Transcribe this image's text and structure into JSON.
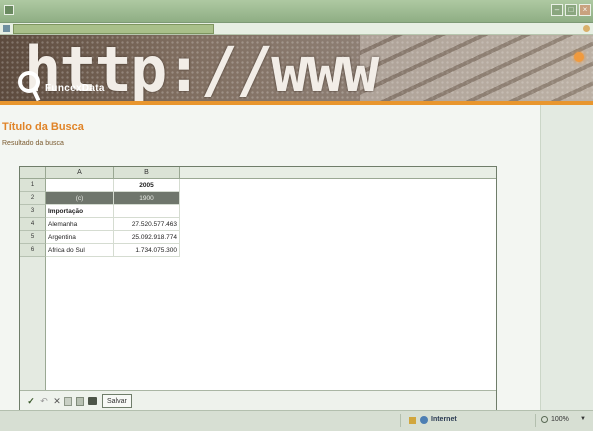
{
  "window": {
    "title": "",
    "url": ""
  },
  "banner": {
    "big_text": "http://www",
    "logo_text": "FuncexData"
  },
  "page": {
    "title": "Título da Busca",
    "subtitle": "Resultado da busca"
  },
  "sheet": {
    "columns": [
      "A",
      "B"
    ],
    "rows": [
      {
        "num": "1",
        "a": "",
        "b": "2005"
      },
      {
        "num": "2",
        "a": "(c)",
        "b": "1900"
      },
      {
        "num": "3",
        "a": "Importação",
        "b": ""
      },
      {
        "num": "4",
        "a": "Alemanha",
        "b": "27.520.577.463"
      },
      {
        "num": "5",
        "a": "Argentina",
        "b": "25.092.918.774"
      },
      {
        "num": "6",
        "a": "Africa do Sul",
        "b": "1.734.075.300"
      }
    ],
    "save_label": "Salvar"
  },
  "toolbar_icons": [
    "check-icon",
    "undo-icon",
    "cut-icon",
    "copy-icon",
    "paste-icon",
    "print-icon"
  ],
  "status": {
    "zone": "Internet",
    "zoom": "100%"
  },
  "colors": {
    "accent": "#e08428",
    "banner_bar": "#e8962e",
    "header_row_dark": "#6f766c"
  }
}
